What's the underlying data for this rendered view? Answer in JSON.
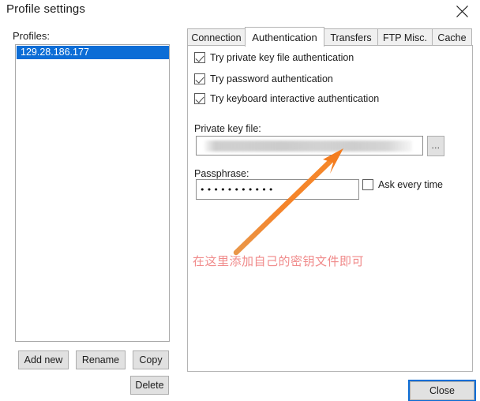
{
  "window": {
    "title": "Profile settings",
    "close_icon": "close-x-icon"
  },
  "left_panel": {
    "profiles_label": "Profiles:",
    "profiles": [
      {
        "name": "129.28.186.177",
        "selected": true
      }
    ],
    "buttons": {
      "add_new": "Add new",
      "rename": "Rename",
      "copy": "Copy",
      "delete": "Delete"
    }
  },
  "tabs": [
    {
      "label": "Connection",
      "active": false
    },
    {
      "label": "Authentication",
      "active": true
    },
    {
      "label": "Transfers",
      "active": false
    },
    {
      "label": "FTP Misc.",
      "active": false
    },
    {
      "label": "Cache",
      "active": false
    }
  ],
  "authentication": {
    "checkboxes": [
      {
        "label": "Try private key file authentication",
        "checked": true
      },
      {
        "label": "Try password authentication",
        "checked": true
      },
      {
        "label": "Try keyboard interactive authentication",
        "checked": true
      }
    ],
    "private_key_file": {
      "label": "Private key file:",
      "value": "",
      "redacted": true,
      "browse_label": "..."
    },
    "passphrase": {
      "label": "Passphrase:",
      "value": "•••••••••••",
      "ask_every_time": {
        "label": "Ask every time",
        "checked": false
      }
    }
  },
  "annotation": {
    "text": "在这里添加自己的密钥文件即可",
    "arrow_color": "#f07c22",
    "text_color": "#f08a8a"
  },
  "footer": {
    "close_label": "Close"
  },
  "colors": {
    "selection_blue": "#0c6dd6",
    "button_face": "#e1e1e1",
    "border_gray": "#adadad"
  }
}
